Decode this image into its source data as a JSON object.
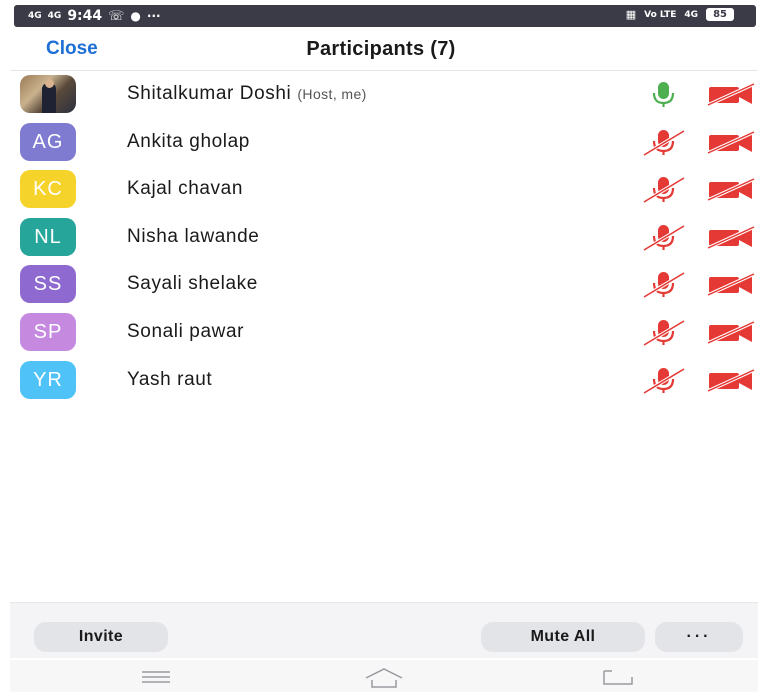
{
  "status_bar": {
    "signal_left": "4G",
    "time": "9:44",
    "extras": "···",
    "battery": "85",
    "signal_right": "4G"
  },
  "header": {
    "close_label": "Close",
    "title": "Participants (7)"
  },
  "participants": [
    {
      "name": "Shitalkumar Doshi",
      "tag": "(Host, me)",
      "initials": "",
      "avatar_color": "#8b7355",
      "has_photo": true,
      "mic": "on",
      "video": "off"
    },
    {
      "name": "Ankita gholap",
      "tag": "",
      "initials": "AG",
      "avatar_color": "#7e7bd1",
      "has_photo": false,
      "mic": "muted",
      "video": "off"
    },
    {
      "name": "Kajal chavan",
      "tag": "",
      "initials": "KC",
      "avatar_color": "#f5d32b",
      "has_photo": false,
      "mic": "muted",
      "video": "off"
    },
    {
      "name": "Nisha lawande",
      "tag": "",
      "initials": "NL",
      "avatar_color": "#26a69a",
      "has_photo": false,
      "mic": "muted",
      "video": "off"
    },
    {
      "name": "Sayali shelake",
      "tag": "",
      "initials": "SS",
      "avatar_color": "#8e6ad0",
      "has_photo": false,
      "mic": "muted",
      "video": "off"
    },
    {
      "name": "Sonali pawar",
      "tag": "",
      "initials": "SP",
      "avatar_color": "#c58ae0",
      "has_photo": false,
      "mic": "muted",
      "video": "off"
    },
    {
      "name": "Yash raut",
      "tag": "",
      "initials": "YR",
      "avatar_color": "#4fc3f7",
      "has_photo": false,
      "mic": "muted",
      "video": "off"
    }
  ],
  "toolbar": {
    "invite_label": "Invite",
    "mute_all_label": "Mute All",
    "more_label": "···"
  },
  "colors": {
    "accent": "#1d6fd6",
    "mic_on": "#4caf50",
    "muted_red": "#e53935"
  },
  "icons": {
    "mic_on": "microphone-icon",
    "mic_muted": "microphone-muted-icon",
    "video_off": "video-off-icon",
    "nav_menu": "menu-icon",
    "nav_home": "home-icon",
    "nav_back": "back-icon"
  }
}
